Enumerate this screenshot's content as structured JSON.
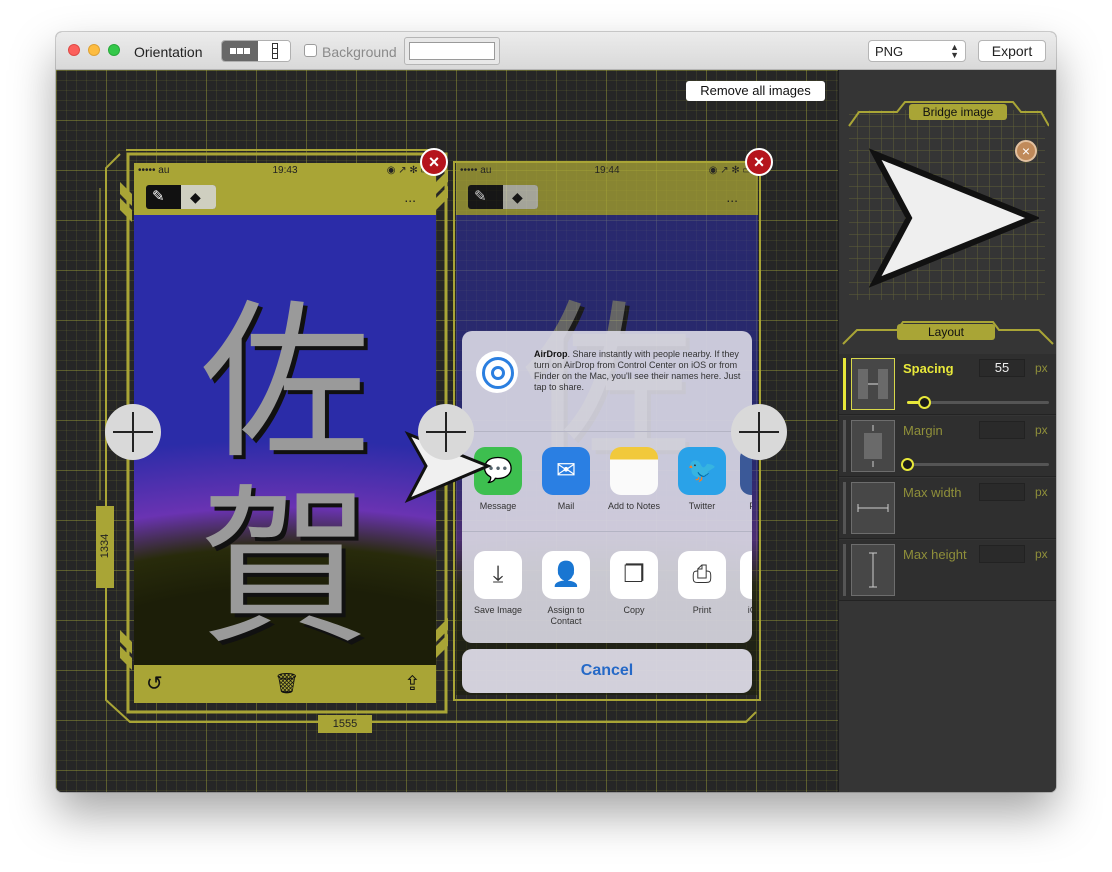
{
  "toolbar": {
    "orientation_label": "Orientation",
    "background_label": "Background",
    "format_value": "PNG",
    "export_label": "Export"
  },
  "canvas": {
    "remove_all_label": "Remove all images",
    "dim_height": "1334",
    "dim_width": "1555",
    "phone1": {
      "carrier": "••••• au",
      "time": "19:43",
      "status_icons": "◉ ↗ ✻ ▭",
      "more": "...",
      "kanji_top": "佐",
      "kanji_bottom": "賀"
    },
    "phone2": {
      "carrier": "••••• au",
      "time": "19:44",
      "status_icons": "◉ ↗ ✻ ▭",
      "more": "...",
      "kanji_top": "佐",
      "airdrop_title": "AirDrop",
      "airdrop_text": ". Share instantly with people nearby. If they turn on AirDrop from Control Center on iOS or from Finder on the Mac, you'll see their names here. Just tap to share.",
      "share_apps": [
        "Message",
        "Mail",
        "Add to Notes",
        "Twitter",
        "F"
      ],
      "share_actions": [
        "Save Image",
        "Assign to Contact",
        "Copy",
        "Print",
        "iC"
      ],
      "cancel_label": "Cancel"
    }
  },
  "panel": {
    "bridge_title": "Bridge image",
    "layout_title": "Layout",
    "rows": [
      {
        "name": "Spacing",
        "value": "55",
        "unit": "px",
        "slider": 0.12
      },
      {
        "name": "Margin",
        "value": "",
        "unit": "px",
        "slider": 0.0
      },
      {
        "name": "Max width",
        "value": "",
        "unit": "px"
      },
      {
        "name": "Max height",
        "value": "",
        "unit": "px"
      }
    ]
  },
  "colors": {
    "accent": "#a9a536",
    "active": "#e8e83a",
    "delete": "#b5141c"
  }
}
